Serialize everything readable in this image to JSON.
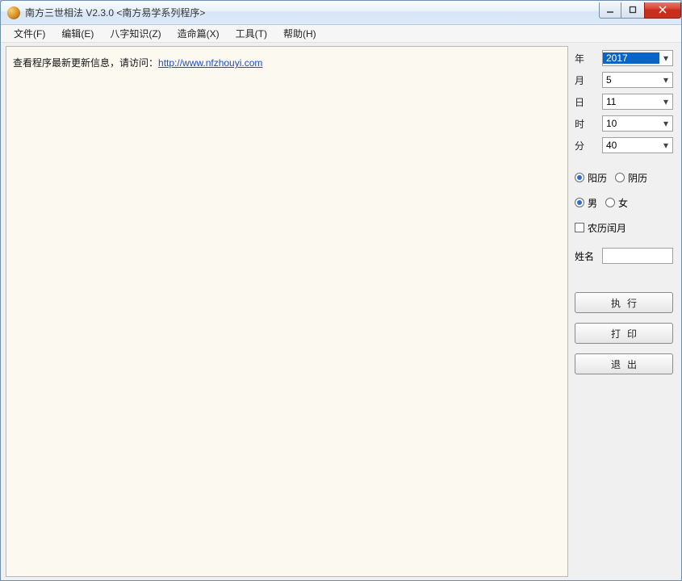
{
  "title": "南方三世相法 V2.3.0   <南方易学系列程序>",
  "menu": [
    "文件(F)",
    "编辑(E)",
    "八字知识(Z)",
    "造命篇(X)",
    "工具(T)",
    "帮助(H)"
  ],
  "main": {
    "prefix": "查看程序最新更新信息，请访问：",
    "link_text": "http://www.nfzhouyi.com",
    "link_href": "http://www.nfzhouyi.com"
  },
  "side": {
    "fields": {
      "year": {
        "label": "年",
        "value": "2017"
      },
      "month": {
        "label": "月",
        "value": "5"
      },
      "day": {
        "label": "日",
        "value": "11"
      },
      "hour": {
        "label": "时",
        "value": "10"
      },
      "minute": {
        "label": "分",
        "value": "40"
      }
    },
    "calendar": {
      "solar": "阳历",
      "lunar": "阴历",
      "selected": "solar"
    },
    "gender": {
      "male": "男",
      "female": "女",
      "selected": "male"
    },
    "leap": {
      "label": "农历闰月",
      "checked": false
    },
    "name": {
      "label": "姓名",
      "value": ""
    },
    "buttons": {
      "run": "执行",
      "print": "打印",
      "exit": "退出"
    }
  }
}
